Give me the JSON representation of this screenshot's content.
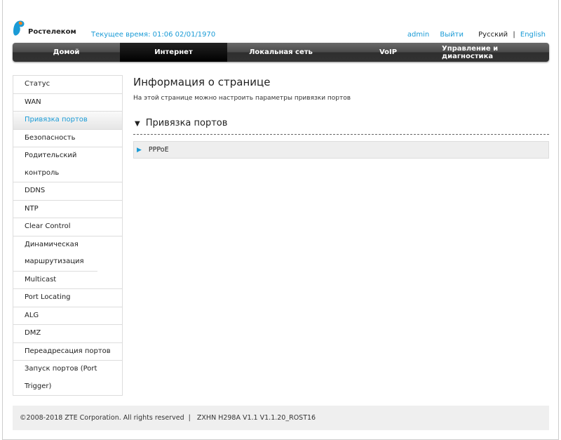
{
  "header": {
    "logo_text": "Ростелеком",
    "time_label": "Текущее время: 01:06 02/01/1970",
    "user": "admin",
    "logout": "Выйти",
    "lang_ru": "Русский",
    "lang_sep": "|",
    "lang_en": "English"
  },
  "nav": [
    "Домой",
    "Интернет",
    "Локальная сеть",
    "VoIP",
    "Управление и диагностика"
  ],
  "sidebar": [
    "Статус",
    "WAN",
    "Привязка портов",
    "Безопасность",
    "Родительский контроль",
    "DDNS",
    "NTP",
    "Clear Control",
    "Динамическая маршрутизация",
    "Multicast",
    "Port Locating",
    "ALG",
    "DMZ",
    "Переадресация портов",
    "Запуск портов (Port Trigger)"
  ],
  "main": {
    "title": "Информация о странице",
    "description": "На этой странице можно настроить параметры привязки портов",
    "section": "Привязка портов",
    "item": "PPPoE"
  },
  "footer": {
    "text": "©2008-2018 ZTE Corporation. All rights reserved  |   ZXHN H298A V1.1 V1.1.20_ROST16"
  },
  "colors": {
    "accent": "#1a9bd6",
    "logo_orange": "#f58220"
  }
}
